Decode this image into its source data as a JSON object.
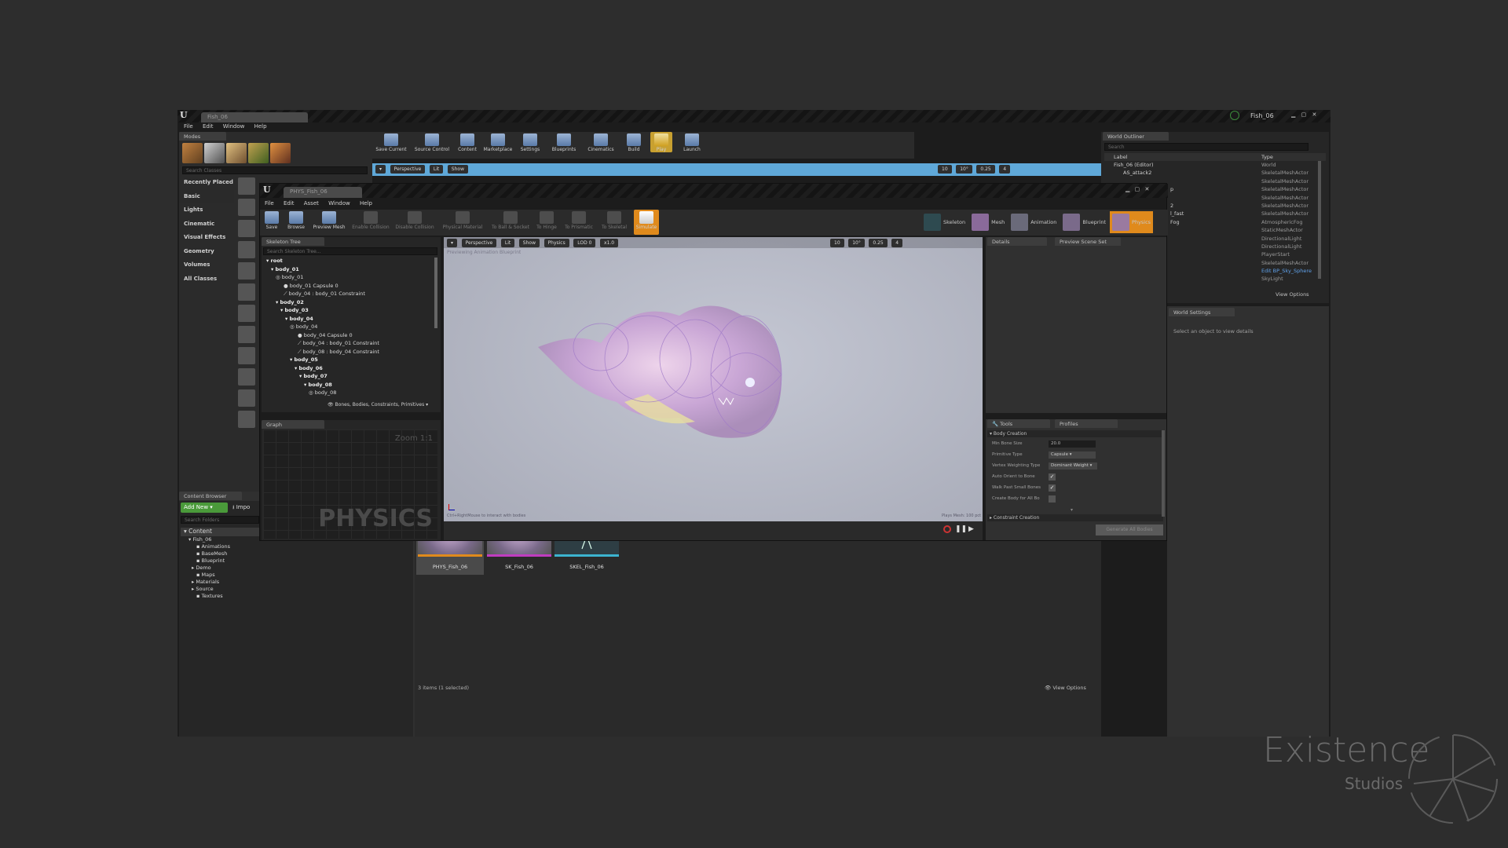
{
  "main_window": {
    "tab_title": "Fish_06",
    "project_name": "Fish_06",
    "menu": [
      "File",
      "Edit",
      "Window",
      "Help"
    ]
  },
  "modes": {
    "tab": "Modes",
    "search_placeholder": "Search Classes",
    "categories": [
      "Recently Placed",
      "Basic",
      "Lights",
      "Cinematic",
      "Visual Effects",
      "Geometry",
      "Volumes",
      "All Classes"
    ],
    "selected_category": "Basic"
  },
  "level_toolbar": {
    "buttons": [
      "Save Current",
      "Source Control",
      "Content",
      "Marketplace",
      "Settings",
      "Blueprints",
      "Cinematics",
      "Build",
      "Play",
      "Launch"
    ]
  },
  "level_viewport": {
    "perspective": "Perspective",
    "lit": "Lit",
    "show": "Show",
    "grid_snap": "10",
    "rot_snap": "10°",
    "scale_snap": "0.25",
    "cam_speed": "4"
  },
  "world_outliner": {
    "tab": "World Outliner",
    "search_placeholder": "Search",
    "col_label": "Label",
    "col_type": "Type",
    "rows": [
      {
        "label": "Fish_06 (Editor)",
        "type": "World"
      },
      {
        "label": "AS_attack2",
        "type": "SkeletalMeshActor"
      },
      {
        "label": "",
        "type": "SkeletalMeshActor"
      },
      {
        "label": "",
        "type": "SkeletalMeshActor"
      },
      {
        "label": "",
        "type": "SkeletalMeshActor"
      },
      {
        "label": "",
        "type": "SkeletalMeshActor"
      },
      {
        "label": "",
        "type": "SkeletalMeshActor"
      },
      {
        "label": "",
        "type": "AtmosphericFog"
      },
      {
        "label": "",
        "type": "StaticMeshActor"
      },
      {
        "label": "",
        "type": "DirectionalLight"
      },
      {
        "label": "",
        "type": "DirectionalLight"
      },
      {
        "label": "",
        "type": "PlayerStart"
      },
      {
        "label": "",
        "type": "SkeletalMeshActor"
      },
      {
        "label": "",
        "type": "Edit BP_Sky_Sphere"
      },
      {
        "label": "",
        "type": "SkyLight"
      }
    ],
    "partial_labels": [
      "p",
      "2",
      "l_fast",
      "Fog"
    ],
    "view_options": "View Options"
  },
  "world_settings": {
    "tab": "World Settings",
    "hint": "Select an object to view details"
  },
  "content_browser": {
    "tab": "Content Browser",
    "add_new": "Add New",
    "import": "Impo",
    "search_folders": "Search Folders",
    "tree": [
      {
        "label": "Content",
        "depth": 0
      },
      {
        "label": "Fish_06",
        "depth": 1
      },
      {
        "label": "Animations",
        "depth": 2
      },
      {
        "label": "BaseMesh",
        "depth": 2
      },
      {
        "label": "Blueprint",
        "depth": 2
      },
      {
        "label": "Demo",
        "depth": 2
      },
      {
        "label": "Maps",
        "depth": 2
      },
      {
        "label": "Materials",
        "depth": 2
      },
      {
        "label": "Source",
        "depth": 2
      },
      {
        "label": "Textures",
        "depth": 2
      }
    ],
    "assets": [
      {
        "name": "PHYS_Fish_06",
        "color": "#e08a1c"
      },
      {
        "name": "SK_Fish_06",
        "color": "#c03cc0"
      },
      {
        "name": "SKEL_Fish_06",
        "color": "#3cb4d0"
      }
    ],
    "status": "3 items (1 selected)",
    "view_options": "View Options"
  },
  "phat": {
    "tab_title": "PHYS_Fish_06",
    "menu": [
      "File",
      "Edit",
      "Asset",
      "Window",
      "Help"
    ],
    "toolbar": [
      "Save",
      "Browse",
      "Preview Mesh",
      "Enable Collision",
      "Disable Collision",
      "Physical Material",
      "To Ball & Socket",
      "To Hinge",
      "To Prismatic",
      "To Skeletal",
      "Simulate"
    ],
    "modes": [
      "Skeleton",
      "Mesh",
      "Animation",
      "Blueprint",
      "Physics"
    ],
    "skeleton_tree": {
      "tab": "Skeleton Tree",
      "search_placeholder": "Search Skeleton Tree...",
      "rows": [
        {
          "label": "root",
          "depth": 0,
          "bold": true
        },
        {
          "label": "body_01",
          "depth": 1,
          "bold": true
        },
        {
          "label": "body_01",
          "depth": 2,
          "bold": false
        },
        {
          "label": "body_01 Capsule 0",
          "depth": 3,
          "bold": false
        },
        {
          "label": "body_04 : body_01 Constraint",
          "depth": 3,
          "bold": false
        },
        {
          "label": "body_02",
          "depth": 2,
          "bold": true
        },
        {
          "label": "body_03",
          "depth": 3,
          "bold": true
        },
        {
          "label": "body_04",
          "depth": 4,
          "bold": true
        },
        {
          "label": "body_04",
          "depth": 5,
          "bold": false
        },
        {
          "label": "body_04 Capsule 0",
          "depth": 6,
          "bold": false
        },
        {
          "label": "body_04 : body_01 Constraint",
          "depth": 6,
          "bold": false
        },
        {
          "label": "body_08 : body_04 Constraint",
          "depth": 6,
          "bold": false
        },
        {
          "label": "body_05",
          "depth": 5,
          "bold": true
        },
        {
          "label": "body_06",
          "depth": 6,
          "bold": true
        },
        {
          "label": "body_07",
          "depth": 7,
          "bold": true
        },
        {
          "label": "body_08",
          "depth": 8,
          "bold": true
        },
        {
          "label": "body_08",
          "depth": 9,
          "bold": false
        }
      ],
      "filter": "Bones, Bodies, Constraints, Primitives"
    },
    "graph": {
      "tab": "Graph",
      "zoom": "Zoom 1:1",
      "watermark": "PHYSICS"
    },
    "viewport": {
      "perspective": "Perspective",
      "lit": "Lit",
      "show": "Show",
      "physics": "Physics",
      "lod": "LOD 0",
      "speed": "x1.0",
      "grid_snap": "10",
      "rot_snap": "10°",
      "scale_snap": "0.25",
      "cam_speed": "4",
      "overlay_text": "Previewing Animation Blueprint",
      "bottom_hint": "Ctrl+RightMouse to interact with bodies",
      "bottom_right": "Plays Mesh: 100 pct"
    },
    "details": {
      "tab": "Details",
      "tab2": "Preview Scene Set"
    },
    "tools": {
      "tab": "Tools",
      "tab2": "Profiles",
      "section1": "Body Creation",
      "fields": [
        {
          "label": "Min Bone Size",
          "value": "20.0",
          "kind": "number"
        },
        {
          "label": "Primitive Type",
          "value": "Capsule",
          "kind": "select"
        },
        {
          "label": "Vertex Weighting Type",
          "value": "Dominant Weight",
          "kind": "select"
        },
        {
          "label": "Auto Orient to Bone",
          "value": "",
          "kind": "checkbox",
          "checked": true
        },
        {
          "label": "Walk Past Small Bones",
          "value": "",
          "kind": "checkbox",
          "checked": true
        },
        {
          "label": "Create Body for All Bo",
          "value": "",
          "kind": "checkbox",
          "checked": false
        }
      ],
      "section2": "Constraint Creation",
      "generate_button": "Generate All Bodies"
    }
  },
  "watermark": {
    "title": "Existence",
    "subtitle": "Studios"
  }
}
